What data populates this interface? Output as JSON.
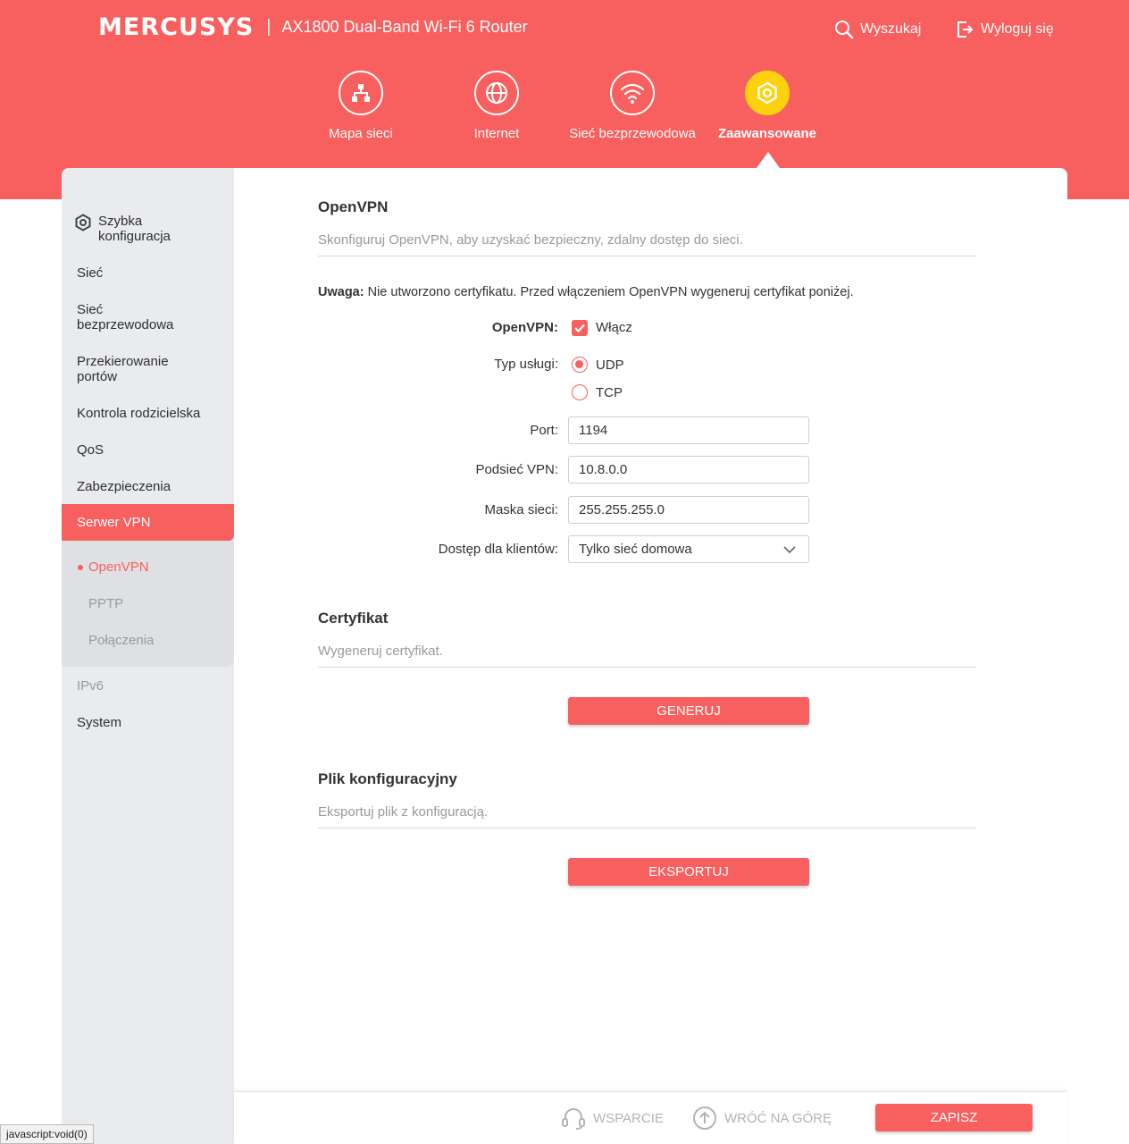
{
  "header": {
    "logo": "MERCUSYS",
    "separator": "|",
    "model": "AX1800 Dual-Band Wi-Fi 6 Router",
    "search_label": "Wyszukaj",
    "logout_label": "Wyloguj się"
  },
  "nav": [
    {
      "label": "Mapa sieci",
      "icon": "network-map-icon"
    },
    {
      "label": "Internet",
      "icon": "globe-icon"
    },
    {
      "label": "Sieć bezprzewodowa",
      "icon": "wifi-icon"
    },
    {
      "label": "Zaawansowane",
      "icon": "gear-icon",
      "active": true
    }
  ],
  "sidebar": {
    "items": [
      {
        "label": "Szybka konfiguracja",
        "icon": "gear-icon"
      },
      {
        "label": "Sieć"
      },
      {
        "label": "Sieć bezprzewodowa"
      },
      {
        "label": "Przekierowanie portów"
      },
      {
        "label": "Kontrola rodzicielska"
      },
      {
        "label": "QoS"
      },
      {
        "label": "Zabezpieczenia"
      },
      {
        "label": "Serwer VPN",
        "active": true
      },
      {
        "label": "IPv6"
      },
      {
        "label": "System"
      }
    ],
    "subitems": [
      {
        "label": "OpenVPN",
        "active": true
      },
      {
        "label": "PPTP"
      },
      {
        "label": "Połączenia"
      }
    ]
  },
  "openvpn": {
    "title": "OpenVPN",
    "description": "Skonfiguruj OpenVPN, aby uzyskać bezpieczny, zdalny dostęp do sieci.",
    "note_label": "Uwaga:",
    "note_text": " Nie utworzono certyfikatu. Przed włączeniem OpenVPN wygeneruj certyfikat poniżej.",
    "enable_label": "OpenVPN:",
    "enable_option": "Włącz",
    "enabled": true,
    "service_type_label": "Typ usługi:",
    "service_types": [
      "UDP",
      "TCP"
    ],
    "service_type_selected": "UDP",
    "port_label": "Port:",
    "port_value": "1194",
    "subnet_label": "Podsieć VPN:",
    "subnet_value": "10.8.0.0",
    "netmask_label": "Maska sieci:",
    "netmask_value": "255.255.255.0",
    "client_access_label": "Dostęp dla klientów:",
    "client_access_value": "Tylko sieć domowa"
  },
  "certificate": {
    "title": "Certyfikat",
    "description": "Wygeneruj certyfikat.",
    "button": "GENERUJ"
  },
  "config_file": {
    "title": "Plik konfiguracyjny",
    "description": "Eksportuj plik z konfiguracją.",
    "button": "EKSPORTUJ"
  },
  "footer": {
    "support": "WSPARCIE",
    "back_to_top": "WRÓĆ NA GÓRĘ",
    "save": "ZAPISZ"
  },
  "status_bar": "javascript:void(0)",
  "colors": {
    "accent": "#f85f5f",
    "active_nav": "#fdd10b",
    "sidebar_bg": "#eaebee"
  }
}
